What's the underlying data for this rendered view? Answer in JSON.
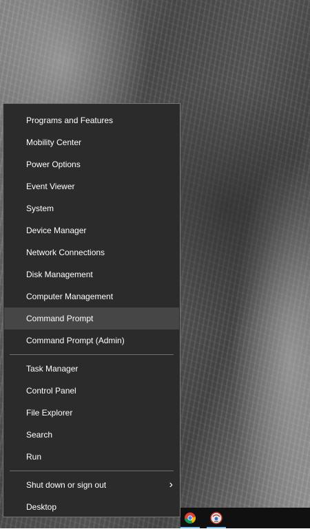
{
  "menu": {
    "group1": [
      {
        "label": "Programs and Features"
      },
      {
        "label": "Mobility Center"
      },
      {
        "label": "Power Options"
      },
      {
        "label": "Event Viewer"
      },
      {
        "label": "System"
      },
      {
        "label": "Device Manager"
      },
      {
        "label": "Network Connections"
      },
      {
        "label": "Disk Management"
      },
      {
        "label": "Computer Management"
      },
      {
        "label": "Command Prompt"
      },
      {
        "label": "Command Prompt (Admin)"
      }
    ],
    "group2": [
      {
        "label": "Task Manager"
      },
      {
        "label": "Control Panel"
      },
      {
        "label": "File Explorer"
      },
      {
        "label": "Search"
      },
      {
        "label": "Run"
      }
    ],
    "group3": [
      {
        "label": "Shut down or sign out",
        "submenu_icon": "chevron-right-icon"
      },
      {
        "label": "Desktop"
      }
    ],
    "highlighted_item": "Command Prompt",
    "chevron_glyph": "›"
  },
  "taskbar": {
    "icons": [
      "chrome-icon",
      "browser-icon"
    ],
    "active_indicator_color": "#76b9ed"
  }
}
